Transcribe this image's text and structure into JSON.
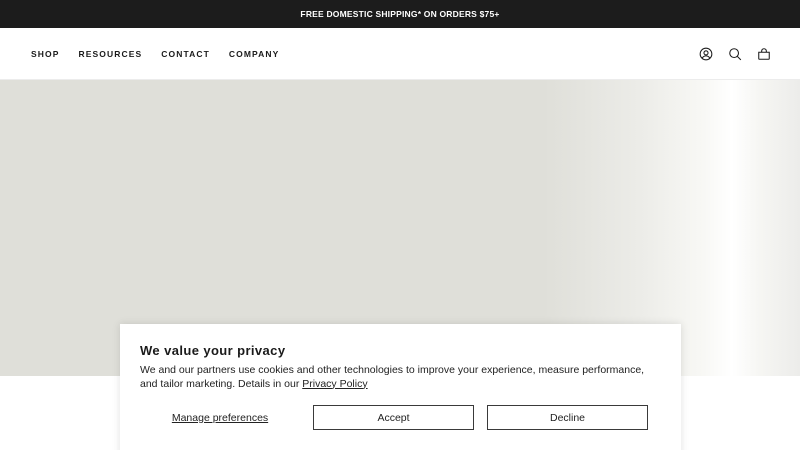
{
  "announcement": {
    "text": "FREE DOMESTIC SHIPPING* ON ORDERS $75+"
  },
  "nav": {
    "items": [
      {
        "label": "SHOP"
      },
      {
        "label": "RESOURCES"
      },
      {
        "label": "CONTACT"
      },
      {
        "label": "COMPANY"
      }
    ]
  },
  "header_icons": [
    "account-icon",
    "search-icon",
    "cart-icon"
  ],
  "cookie_banner": {
    "title": "We value your privacy",
    "text_before_link": "We and our partners use cookies and other technologies to improve your experience, measure performance, and tailor marketing. Details in our ",
    "link_label": "Privacy Policy",
    "manage_label": "Manage preferences",
    "accept_label": "Accept",
    "decline_label": "Decline"
  },
  "colors": {
    "announcement_bg": "#1c1c1c",
    "hero_bg": "#dfdfd9",
    "text": "#1a1a1a"
  }
}
